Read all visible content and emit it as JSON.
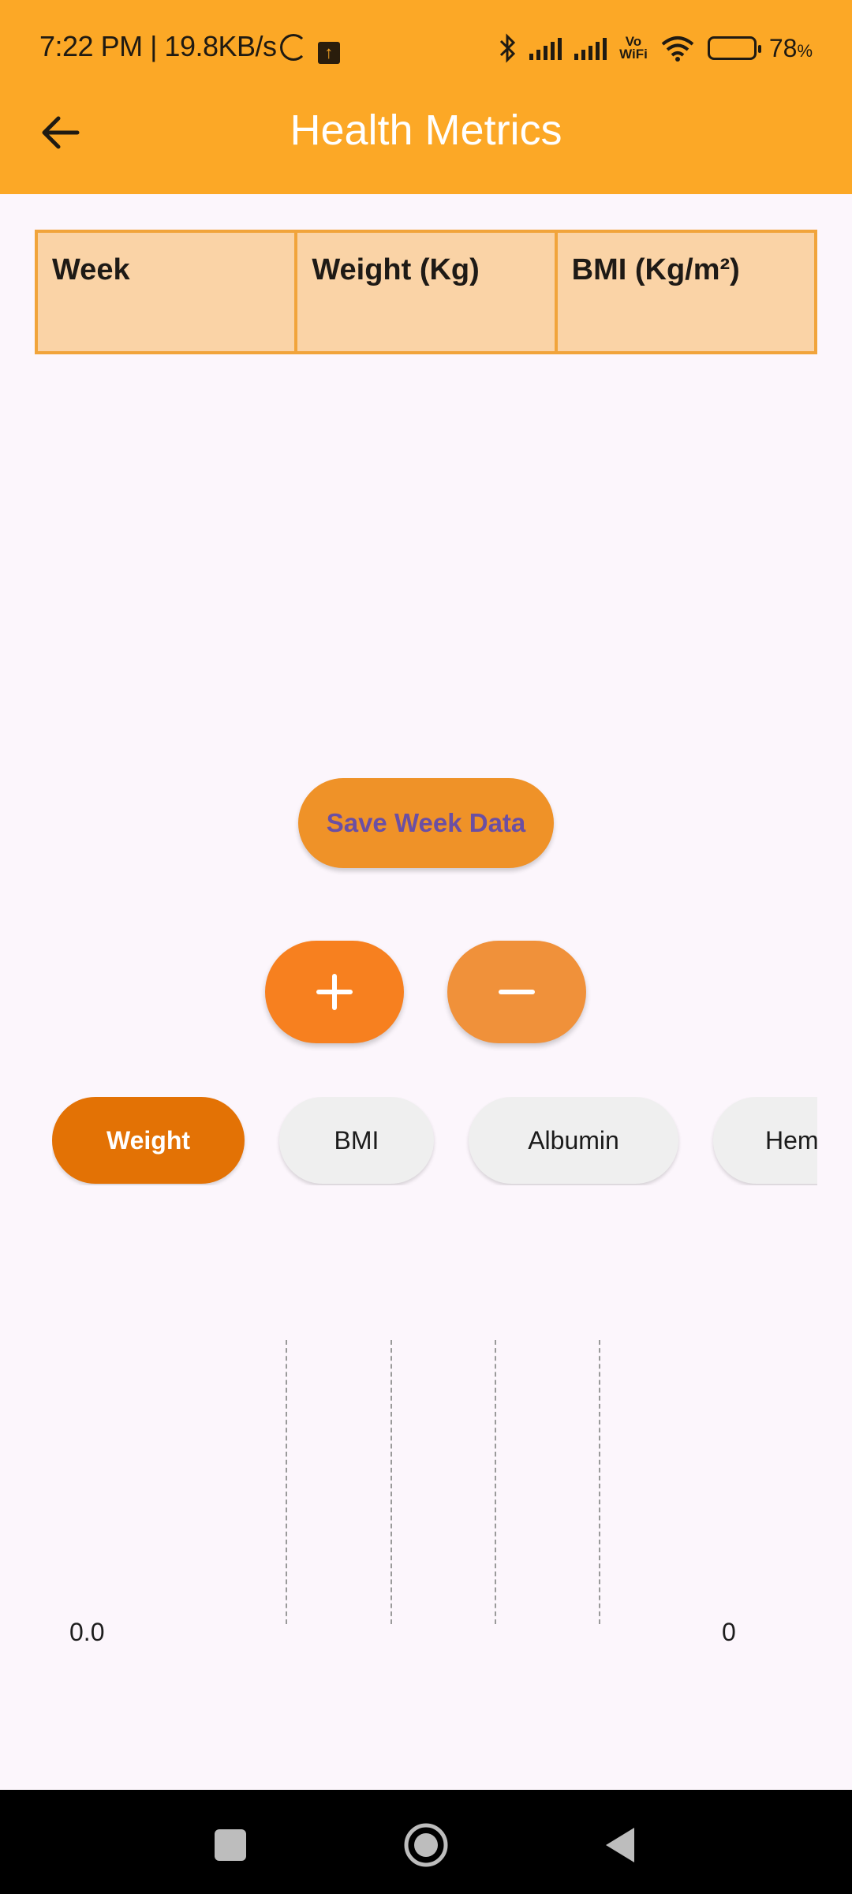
{
  "status_bar": {
    "time_speed": "7:22 PM | 19.8KB/s",
    "vowifi_top": "Vo",
    "vowifi_bottom": "WiFi",
    "battery_value": "78",
    "battery_unit": "%"
  },
  "header": {
    "title": "Health Metrics"
  },
  "table": {
    "headers": [
      "Week",
      "Weight (Kg)",
      "BMI (Kg/m²)"
    ]
  },
  "actions": {
    "save_label": "Save Week Data",
    "add_label": "+",
    "remove_label": "−"
  },
  "metric_tabs": [
    "Weight",
    "BMI",
    "Albumin",
    "Hemoglobin"
  ],
  "selected_tab": "Weight",
  "chart_data": {
    "type": "line",
    "y_tick_label": "0.0",
    "x_tick_label": "0",
    "series": [],
    "grid": true
  },
  "colors": {
    "app_bar": "#fca826",
    "accent": "#e37205",
    "table_fill": "#fad3a6"
  }
}
